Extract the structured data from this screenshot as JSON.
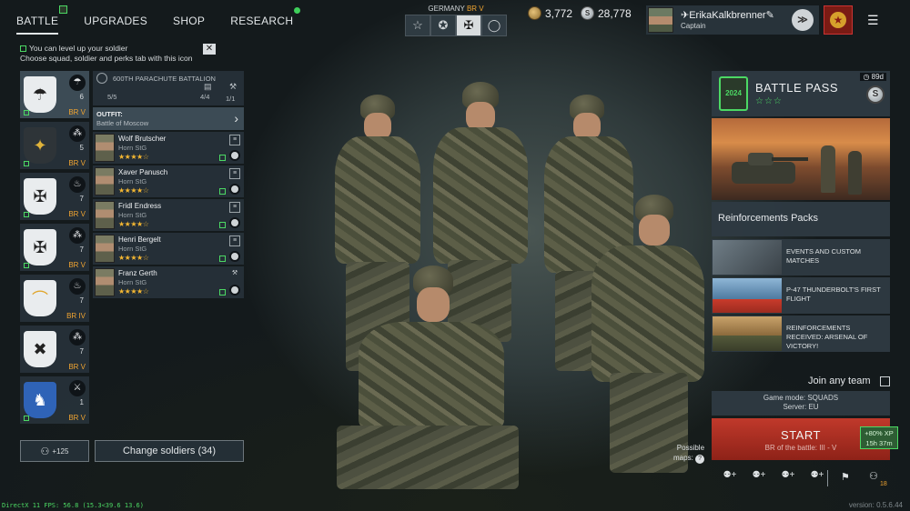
{
  "nav": {
    "tabs": [
      {
        "label": "BATTLE"
      },
      {
        "label": "UPGRADES"
      },
      {
        "label": "SHOP"
      },
      {
        "label": "RESEARCH"
      }
    ]
  },
  "tip": {
    "line1": "You can level up your soldier",
    "line2": "Choose squad, soldier and perks tab with this icon",
    "close": "✕"
  },
  "squads": [
    {
      "count": "6",
      "br": "BR V",
      "emblem": "parachute-emblem",
      "kind": "parachute-icon",
      "glyph": "☂",
      "kind_glyph": "☂"
    },
    {
      "count": "5",
      "br": "BR V",
      "emblem": "eagle-emblem",
      "kind": "rifle-icon",
      "glyph": "✦",
      "kind_glyph": "⁂"
    },
    {
      "count": "7",
      "br": "BR V",
      "emblem": "cross-emblem",
      "kind": "flame-icon",
      "glyph": "✠",
      "kind_glyph": "♨"
    },
    {
      "count": "7",
      "br": "BR V",
      "emblem": "cross-emblem",
      "kind": "squad-icon",
      "glyph": "✠",
      "kind_glyph": "⁂"
    },
    {
      "count": "7",
      "br": "BR IV",
      "emblem": "bow-emblem",
      "kind": "flame-icon",
      "glyph": "⌒",
      "kind_glyph": "♨"
    },
    {
      "count": "7",
      "br": "BR V",
      "emblem": "cross-swords-emblem",
      "kind": "squad-icon",
      "glyph": "✖",
      "kind_glyph": "⁂"
    },
    {
      "count": "1",
      "br": "BR V",
      "emblem": "lion-emblem",
      "kind": "sword-icon",
      "glyph": "♞",
      "kind_glyph": "⚔"
    }
  ],
  "battalion": {
    "name": "600TH PARACHUTE BATTALION",
    "slots": "5/5",
    "capacity": "4/4",
    "perks": "1/1"
  },
  "outfit": {
    "label": "OUTFIT:",
    "value": "Battle of Moscow"
  },
  "soldiers": [
    {
      "name": "Wolf Brutscher",
      "weapon": "Horn StG",
      "stars": "★★★★☆"
    },
    {
      "name": "Xaver Panusch",
      "weapon": "Horn StG",
      "stars": "★★★★☆"
    },
    {
      "name": "Fridl Endress",
      "weapon": "Horn StG",
      "stars": "★★★★☆"
    },
    {
      "name": "Henri Bergelt",
      "weapon": "Horn StG",
      "stars": "★★★★☆"
    },
    {
      "name": "Franz Gerth",
      "weapon": "Horn StG",
      "stars": "★★★★☆"
    }
  ],
  "buttons": {
    "recruit": "+125",
    "change": "Change soldiers (34)"
  },
  "debug": "DirectX 11 FPS: 56.8 (15.3<39.6 13.6)",
  "version": "version: 0.5.6.44",
  "nation": {
    "name": "GERMANY",
    "br": "BR V",
    "tabs": [
      "☆",
      "✪",
      "✠",
      "◯"
    ]
  },
  "currency": {
    "gold": "3,772",
    "silver": "28,778"
  },
  "profile": {
    "name": "ErikaKalkbrenner",
    "rank": "Captain"
  },
  "battle_pass": {
    "title": "BATTLE PASS",
    "stars": "☆☆☆",
    "days": "89d",
    "logo": "2024"
  },
  "reinforcements": "Reinforcements Packs",
  "promos": [
    {
      "text": "EVENTS AND CUSTOM MATCHES"
    },
    {
      "text": "P-47 THUNDERBOLT'S FIRST FLIGHT"
    },
    {
      "text": "REINFORCEMENTS RECEIVED: ARSENAL OF VICTORY!"
    }
  ],
  "join_any": "Join any team",
  "mode": {
    "line1": "Game mode: SQUADS",
    "line2": "Server: EU"
  },
  "start": {
    "label": "START",
    "sub": "BR of the battle: III - V",
    "xp1": "+80% XP",
    "xp2": "15h 37m"
  },
  "maps": {
    "line1": "Possible",
    "line2": "maps:"
  },
  "friends_count": "18"
}
